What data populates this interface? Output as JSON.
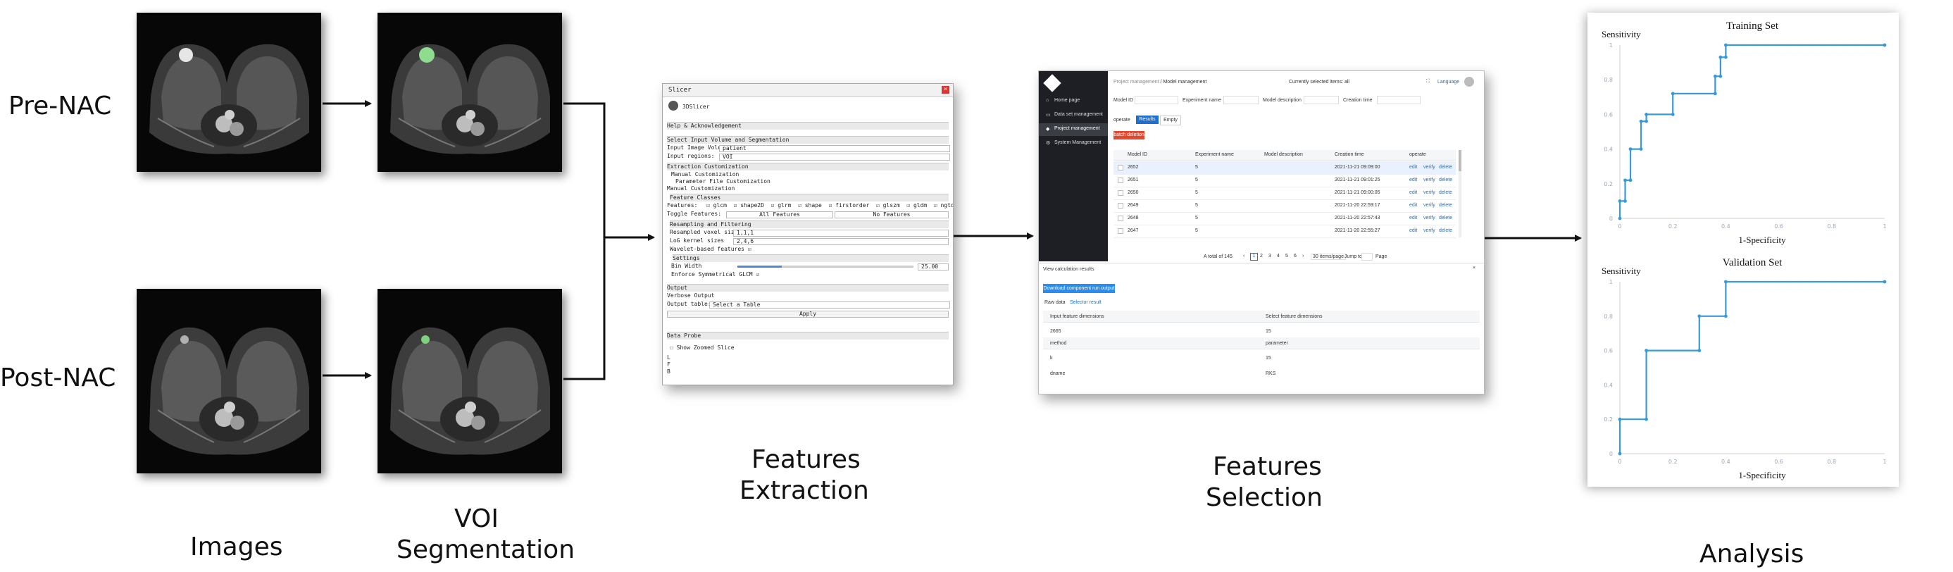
{
  "row_labels": {
    "pre": "Pre-NAC",
    "post": "Post-NAC"
  },
  "stage_labels": {
    "images": "Images",
    "voi_line1": "VOI",
    "voi_line2": "Segmentation",
    "extract_line1": "Features",
    "extract_line2": "Extraction",
    "select_line1": "Features",
    "select_line2": "Selection",
    "analysis": "Analysis"
  },
  "slicer": {
    "title": "Slicer",
    "module": "3DSlicer",
    "help": "Help & Acknowledgement",
    "select_section": "Select Input Volume and Segmentation",
    "input_volume_label": "Input Image Volume:",
    "input_volume_value": "patient",
    "input_regions_label": "Input regions:",
    "input_regions_value": "VOI",
    "extraction_section": "Extraction Customization",
    "manual_radio": "Manual Customization",
    "param_radio": "Parameter File Customization",
    "manual_header": "Manual Customization",
    "feature_classes": "Feature Classes",
    "features_label": "Features:",
    "feature_items": [
      "glcm",
      "shape2D",
      "glrm",
      "shape",
      "firstorder",
      "glszm",
      "gldm",
      "ngtdm"
    ],
    "toggle_label": "Toggle Features:",
    "all_features": "All Features",
    "no_features": "No Features",
    "resampling_section": "Resampling and Filtering",
    "resampled_label": "Resampled voxel size",
    "resampled_value": "1,1,1",
    "log_label": "LoG kernel sizes",
    "log_value": "2,4,6",
    "wavelet_label": "Wavelet-based features",
    "settings_section": "Settings",
    "bin_label": "Bin Width",
    "bin_value": "25.00",
    "enforce_label": "Enforce Symmetrical GLCM",
    "output_section": "Output",
    "verbose_label": "Verbose Output",
    "output_table_label": "Output table:",
    "output_table_value": "Select a Table",
    "apply": "Apply",
    "probe_section": "Data Probe",
    "show_zoomed": "Show Zoomed Slice",
    "probe_lines": [
      "L",
      "F",
      "B"
    ]
  },
  "app": {
    "sidebar": [
      "Home page",
      "Data set management",
      "Project management",
      "System Management"
    ],
    "breadcrumb": [
      "Project management",
      "Model management"
    ],
    "selected_items": "Currently selected items: all",
    "language": "Language",
    "filters": [
      "Model ID",
      "Experiment name",
      "Model description",
      "Creation time"
    ],
    "operate": "operate",
    "tabs": [
      "Results",
      "Empty"
    ],
    "batch_delete": "batch deletion",
    "columns": [
      "Model ID",
      "Experiment name",
      "Model description",
      "Creation time",
      "operate"
    ],
    "rows": [
      {
        "id": "2652",
        "exp": "5",
        "time": "2021-11-21 09:09:00"
      },
      {
        "id": "2651",
        "exp": "5",
        "time": "2021-11-21 09:01:25"
      },
      {
        "id": "2650",
        "exp": "5",
        "time": "2021-11-21 09:00:05"
      },
      {
        "id": "2649",
        "exp": "5",
        "time": "2021-11-20 22:59:17"
      },
      {
        "id": "2648",
        "exp": "5",
        "time": "2021-11-20 22:57:43"
      },
      {
        "id": "2647",
        "exp": "5",
        "time": "2021-11-20 22:55:27"
      }
    ],
    "row_actions": [
      "edit",
      "verify",
      "delete"
    ],
    "pagination": {
      "total": "A total of 145",
      "pages": [
        "1",
        "2",
        "3",
        "4",
        "5",
        "6"
      ],
      "per_page": "30 items/page",
      "jump": "Jump to",
      "page": "Page"
    },
    "results_title": "View calculation results",
    "download": "Download component run output",
    "raw_data": "Raw data",
    "selector_result": "Selector result",
    "result_headers": [
      "Input feature dimensions",
      "Select feature dimensions"
    ],
    "result_values": [
      "2665",
      "15"
    ],
    "method_headers": [
      "method",
      "parameter"
    ],
    "method_values1": [
      "k",
      "15"
    ],
    "method_values2": [
      "dname",
      "RKS"
    ]
  },
  "chart_data": [
    {
      "type": "line",
      "title": "Training Set",
      "xlabel": "1-Specificity",
      "ylabel": "Sensitivity",
      "xlim": [
        0,
        1
      ],
      "ylim": [
        0,
        1
      ],
      "xticks": [
        "0",
        "0.2",
        "0.4",
        "0.6",
        "0.8",
        "1"
      ],
      "yticks": [
        "0",
        "0.2",
        "0.4",
        "0.6",
        "0.8",
        "1"
      ],
      "color": "#3a9ad9",
      "x": [
        0,
        0,
        0.02,
        0.02,
        0.04,
        0.04,
        0.08,
        0.08,
        0.1,
        0.1,
        0.2,
        0.2,
        0.36,
        0.36,
        0.38,
        0.38,
        0.4,
        0.4,
        1
      ],
      "y": [
        0,
        0.1,
        0.1,
        0.22,
        0.22,
        0.4,
        0.4,
        0.56,
        0.56,
        0.6,
        0.6,
        0.72,
        0.72,
        0.82,
        0.82,
        0.93,
        0.93,
        1.0,
        1.0
      ]
    },
    {
      "type": "line",
      "title": "Validation Set",
      "xlabel": "1-Specificity",
      "ylabel": "Sensitivity",
      "xlim": [
        0,
        1
      ],
      "ylim": [
        0,
        1
      ],
      "xticks": [
        "0",
        "0.2",
        "0.4",
        "0.6",
        "0.8",
        "1"
      ],
      "yticks": [
        "0",
        "0.2",
        "0.4",
        "0.6",
        "0.8",
        "1"
      ],
      "color": "#3a9ad9",
      "x": [
        0,
        0,
        0.1,
        0.1,
        0.3,
        0.3,
        0.4,
        0.4,
        1
      ],
      "y": [
        0,
        0.2,
        0.2,
        0.6,
        0.6,
        0.8,
        0.8,
        1.0,
        1.0
      ]
    }
  ]
}
